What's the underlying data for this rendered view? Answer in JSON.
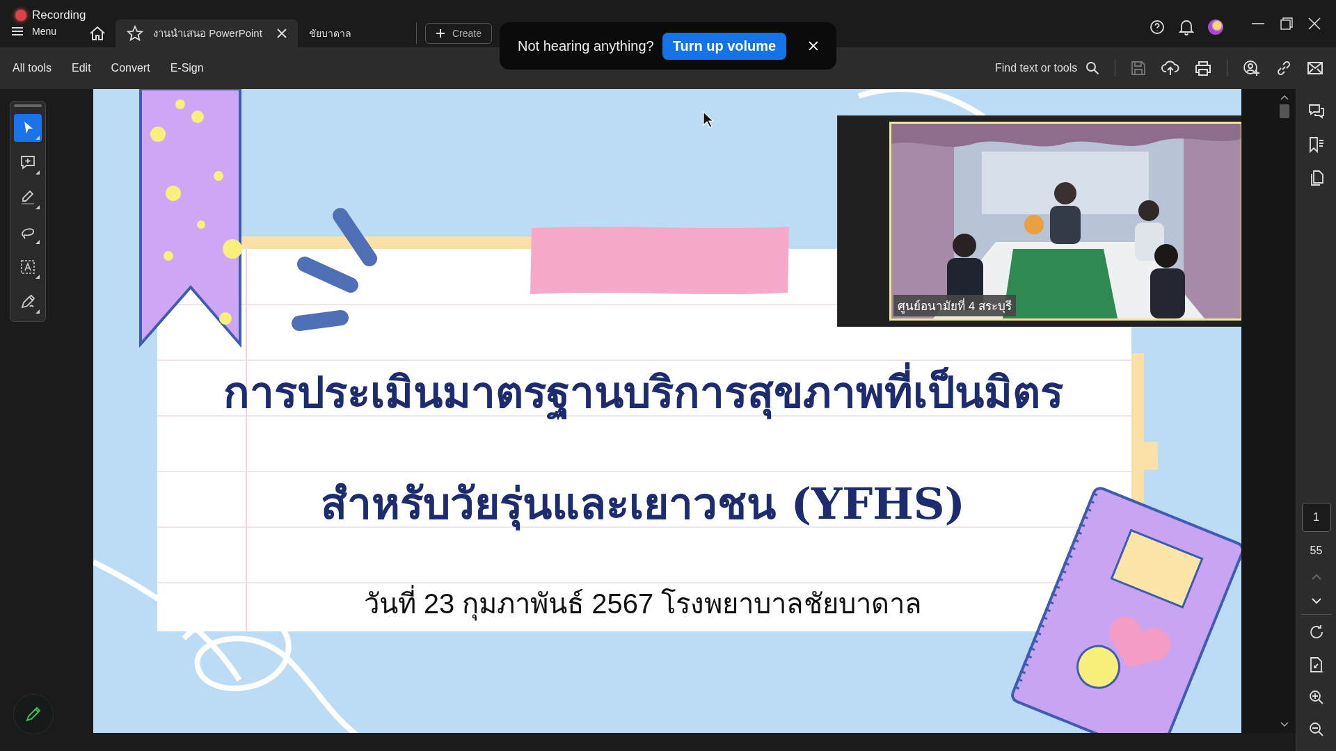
{
  "recording": {
    "label": "Recording"
  },
  "menu": {
    "label": "Menu"
  },
  "tabs": [
    {
      "label": "งานนำเสนอ PowerPoint",
      "selected": true
    },
    {
      "label": "ชัยบาดาล",
      "selected": false
    }
  ],
  "create_button": {
    "label": "Create"
  },
  "toast": {
    "message": "Not hearing anything?",
    "action": "Turn up volume"
  },
  "toolbar": {
    "menus": [
      "All tools",
      "Edit",
      "Convert",
      "E-Sign"
    ],
    "search": {
      "placeholder": "Find text or tools"
    }
  },
  "left_tools": [
    {
      "kind": "select",
      "selected": true
    },
    {
      "kind": "comment",
      "selected": false
    },
    {
      "kind": "highlight",
      "selected": false
    },
    {
      "kind": "lasso",
      "selected": false
    },
    {
      "kind": "text",
      "selected": false
    },
    {
      "kind": "sign",
      "selected": false
    }
  ],
  "slide": {
    "title_lines": [
      "การประเมินมาตรฐานบริการสุขภาพที่เป็นมิตร",
      "สำหรับวัยรุ่นและเยาวชน  (YFHS)"
    ],
    "date_line": "วันที่ 23 กุมภาพันธ์ 2567 โรงพยาบาลชัยบาดาล"
  },
  "video": {
    "caption": "ศูนย์อนามัยที่ 4 สระบุรี"
  },
  "page_nav": {
    "current": "1",
    "total": "55"
  }
}
